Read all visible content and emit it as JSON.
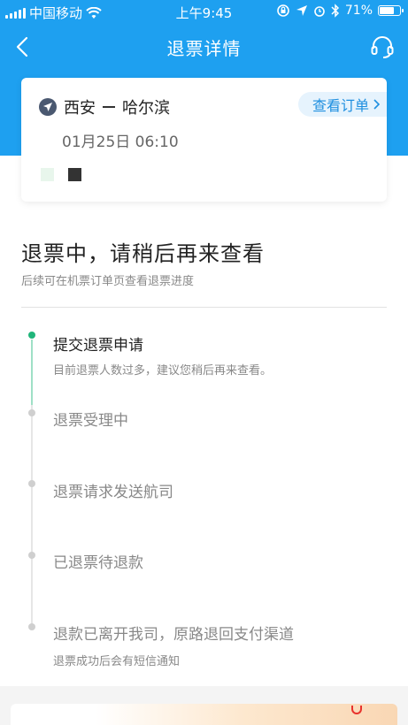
{
  "status_bar": {
    "carrier": "中国移动",
    "time": "上午9:45",
    "battery": "71%",
    "battery_level": 0.71
  },
  "nav": {
    "title": "退票详情",
    "back_icon": "back-arrow-icon",
    "service_icon": "headset-icon"
  },
  "flight": {
    "from": "西安",
    "to": "哈尔滨",
    "datetime": "01月25日 06:10",
    "view_order_label": "查看订单"
  },
  "refund_status": {
    "title": "退票中，请稍后再来查看",
    "subtitle": "后续可在机票订单页查看退票进度"
  },
  "steps": [
    {
      "title": "提交退票申请",
      "desc": "目前退票人数过多，建议您稍后再来查看。",
      "active": true
    },
    {
      "title": "退票受理中",
      "desc": "",
      "active": false
    },
    {
      "title": "退票请求发送航司",
      "desc": "",
      "active": false
    },
    {
      "title": "已退票待退款",
      "desc": "",
      "active": false
    },
    {
      "title": "退款已离开我司，原路退回支付渠道",
      "desc": "退票成功后会有短信通知",
      "active": false
    }
  ],
  "colors": {
    "brand_blue": "#1ea0f0",
    "active_green": "#20b57a",
    "inactive_gray": "#cfcfcf"
  }
}
